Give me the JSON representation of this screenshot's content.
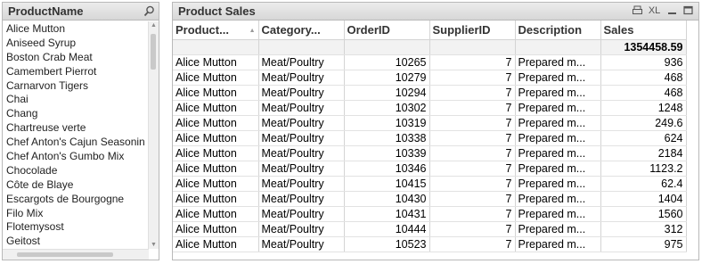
{
  "listbox": {
    "title": "ProductName",
    "items": [
      "Alice Mutton",
      "Aniseed Syrup",
      "Boston Crab Meat",
      "Camembert Pierrot",
      "Carnarvon Tigers",
      "Chai",
      "Chang",
      "Chartreuse verte",
      "Chef Anton's Cajun Seasonin",
      "Chef Anton's Gumbo Mix",
      "Chocolade",
      "Côte de Blaye",
      "Escargots de Bourgogne",
      "Filo Mix",
      "Flotemysost",
      "Geitost"
    ]
  },
  "table": {
    "title": "Product Sales",
    "xl_label": "XL",
    "columns": [
      "Product...",
      "Category...",
      "OrderID",
      "SupplierID",
      "Description",
      "Sales"
    ],
    "total": "1354458.59",
    "rows": [
      [
        "Alice Mutton",
        "Meat/Poultry",
        "10265",
        "7",
        "Prepared m...",
        "936"
      ],
      [
        "Alice Mutton",
        "Meat/Poultry",
        "10279",
        "7",
        "Prepared m...",
        "468"
      ],
      [
        "Alice Mutton",
        "Meat/Poultry",
        "10294",
        "7",
        "Prepared m...",
        "468"
      ],
      [
        "Alice Mutton",
        "Meat/Poultry",
        "10302",
        "7",
        "Prepared m...",
        "1248"
      ],
      [
        "Alice Mutton",
        "Meat/Poultry",
        "10319",
        "7",
        "Prepared m...",
        "249.6"
      ],
      [
        "Alice Mutton",
        "Meat/Poultry",
        "10338",
        "7",
        "Prepared m...",
        "624"
      ],
      [
        "Alice Mutton",
        "Meat/Poultry",
        "10339",
        "7",
        "Prepared m...",
        "2184"
      ],
      [
        "Alice Mutton",
        "Meat/Poultry",
        "10346",
        "7",
        "Prepared m...",
        "1123.2"
      ],
      [
        "Alice Mutton",
        "Meat/Poultry",
        "10415",
        "7",
        "Prepared m...",
        "62.4"
      ],
      [
        "Alice Mutton",
        "Meat/Poultry",
        "10430",
        "7",
        "Prepared m...",
        "1404"
      ],
      [
        "Alice Mutton",
        "Meat/Poultry",
        "10431",
        "7",
        "Prepared m...",
        "1560"
      ],
      [
        "Alice Mutton",
        "Meat/Poultry",
        "10444",
        "7",
        "Prepared m...",
        "312"
      ],
      [
        "Alice Mutton",
        "Meat/Poultry",
        "10523",
        "7",
        "Prepared m...",
        "975"
      ]
    ]
  }
}
